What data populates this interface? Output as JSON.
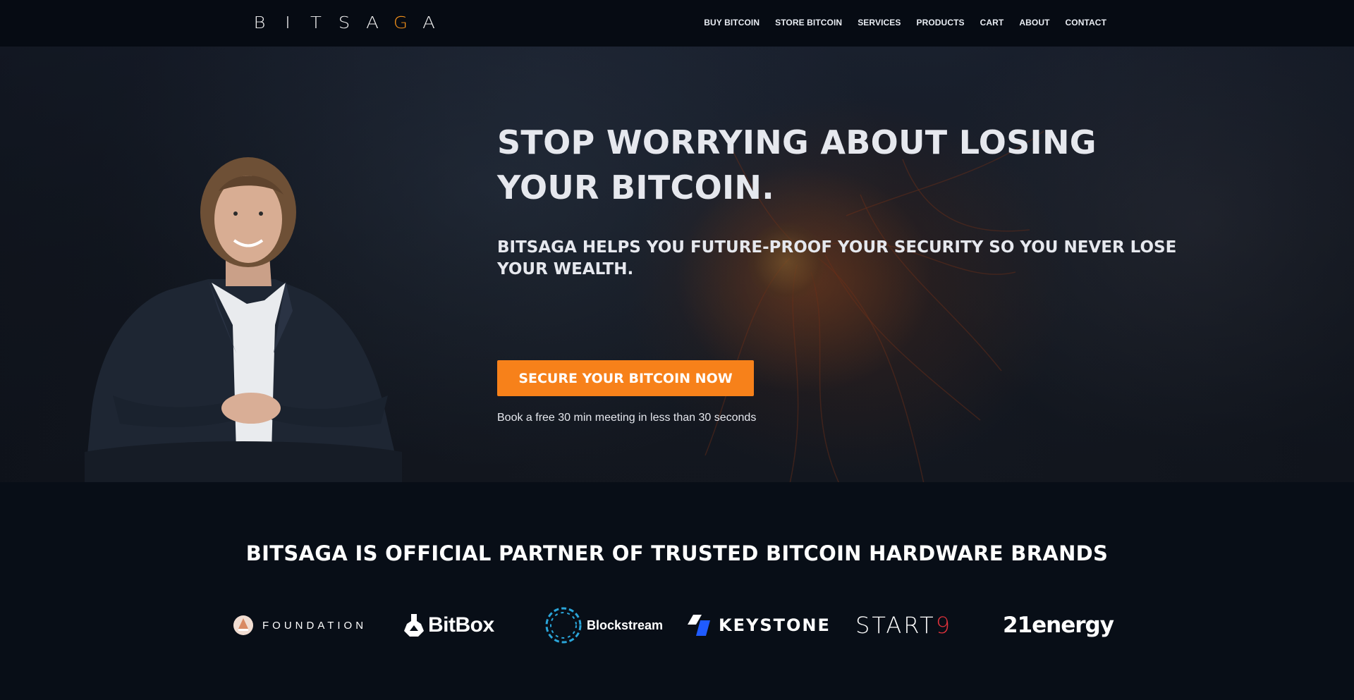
{
  "brand": {
    "logo_letters": [
      "B",
      "I",
      "T",
      "S",
      "A",
      "G",
      "A"
    ],
    "accent_letter_index": 5,
    "accent_color": "#f7931a"
  },
  "nav": {
    "items": [
      "BUY BITCOIN",
      "STORE BITCOIN",
      "SERVICES",
      "PRODUCTS",
      "CART",
      "ABOUT",
      "CONTACT"
    ]
  },
  "hero": {
    "headline": "STOP WORRYING ABOUT LOSING YOUR BITCOIN.",
    "subhead": "BITSAGA HELPS YOU FUTURE-PROOF YOUR SECURITY SO YOU NEVER LOSE YOUR WEALTH.",
    "cta_label": "SECURE YOUR BITCOIN NOW",
    "cta_note": "Book a free 30 min meeting in less than 30 seconds",
    "cta_color": "#f7811a"
  },
  "partners": {
    "title": "BITSAGA IS OFFICIAL PARTNER OF TRUSTED BITCOIN HARDWARE BRANDS",
    "brands": {
      "foundation": "FOUNDATION",
      "bitbox": "BitBox",
      "blockstream": "Blockstream",
      "keystone": "KEYSTONE",
      "start9_prefix": "START",
      "start9_suffix": "9",
      "energy21": "21energy"
    }
  }
}
